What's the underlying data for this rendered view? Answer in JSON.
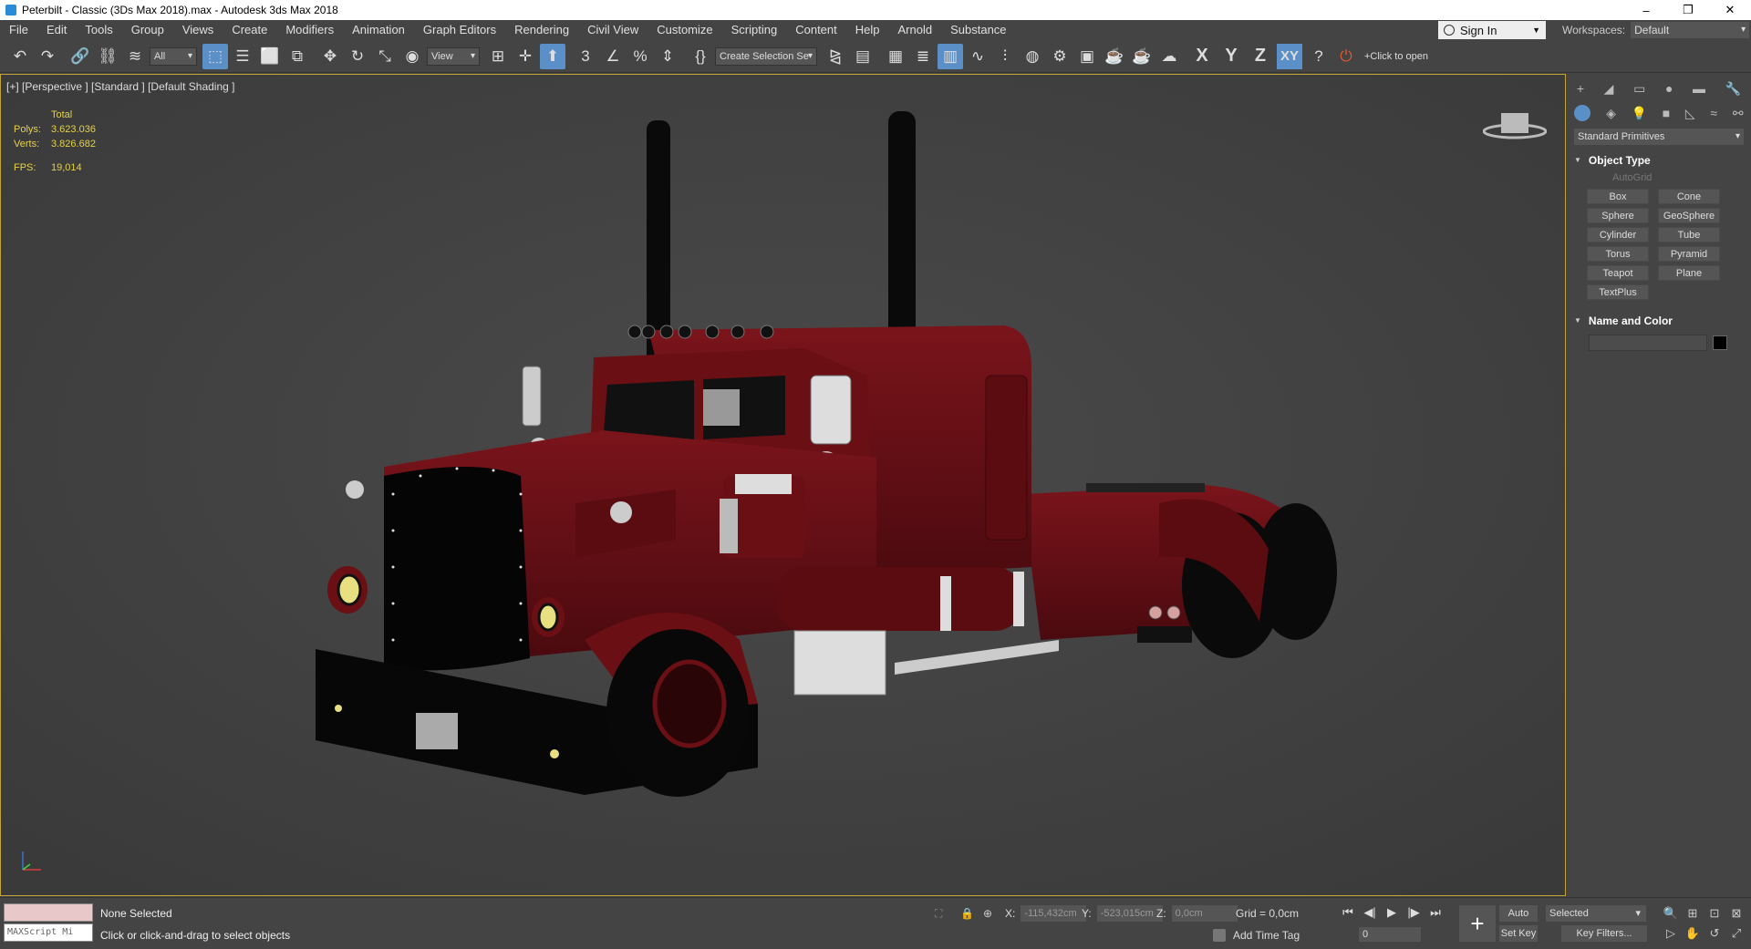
{
  "window": {
    "title": "Peterbilt - Classic (3Ds Max 2018).max - Autodesk 3ds Max 2018",
    "minimize": "–",
    "restore": "❐",
    "close": "✕"
  },
  "menu": [
    "File",
    "Edit",
    "Tools",
    "Group",
    "Views",
    "Create",
    "Modifiers",
    "Animation",
    "Graph Editors",
    "Rendering",
    "Civil View",
    "Customize",
    "Scripting",
    "Content",
    "Help",
    "Arnold",
    "Substance"
  ],
  "signin": {
    "label": "Sign In"
  },
  "workspaces": {
    "label": "Workspaces:",
    "value": "Default"
  },
  "toolbar": {
    "filter_value": "All",
    "refcoord_value": "View",
    "selection_set_placeholder": "Create Selection Se",
    "axis_x": "X",
    "axis_y": "Y",
    "axis_z": "Z",
    "axis_xy": "XY",
    "click_to_open": "+Click to open"
  },
  "viewport": {
    "label": "[+] [Perspective ] [Standard ] [Default Shading ]",
    "stats_header": "Total",
    "polys_label": "Polys:",
    "polys_value": "3.623.036",
    "verts_label": "Verts:",
    "verts_value": "3.826.682",
    "fps_label": "FPS:",
    "fps_value": "19,014"
  },
  "command_panel": {
    "category": "Standard Primitives",
    "object_type_title": "Object Type",
    "autogrid": "AutoGrid",
    "primitives": [
      "Box",
      "Cone",
      "Sphere",
      "GeoSphere",
      "Cylinder",
      "Tube",
      "Torus",
      "Pyramid",
      "Teapot",
      "Plane",
      "TextPlus"
    ],
    "name_color_title": "Name and Color",
    "swatch_color": "#000000"
  },
  "status": {
    "maxscript": "MAXScript Mi",
    "selection": "None Selected",
    "prompt": "Click or click-and-drag to select objects",
    "x_label": "X:",
    "x_value": "-115,432cm",
    "y_label": "Y:",
    "y_value": "-523,015cm",
    "z_label": "Z:",
    "z_value": "0,0cm",
    "grid": "Grid = 0,0cm",
    "add_time_tag": "Add Time Tag",
    "frame": "0",
    "auto_key": "Auto Key",
    "set_key": "Set Key",
    "selected": "Selected",
    "key_filters": "Key Filters..."
  },
  "colors": {
    "truck_body": "#6a0f14",
    "viewport_bg": "#424242",
    "active_accent": "#5b8fc7",
    "stats_text": "#e6d244"
  }
}
